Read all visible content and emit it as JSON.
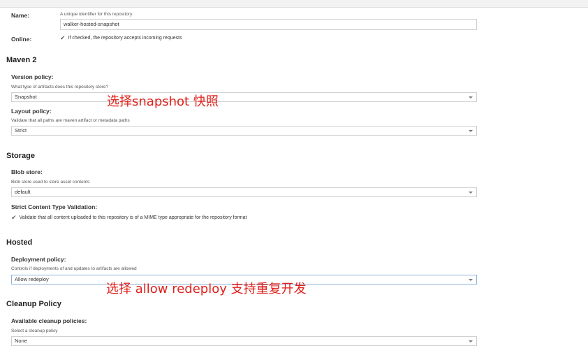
{
  "name": {
    "label": "Name:",
    "help": "A unique identifier for this repository",
    "value": "walker-hosted-snapshot"
  },
  "online": {
    "label": "Online:",
    "checkbox_text": "If checked, the repository accepts incoming requests"
  },
  "maven2": {
    "heading": "Maven 2",
    "version_policy": {
      "label": "Version policy:",
      "help": "What type of artifacts does this repository store?",
      "value": "Snapshot"
    },
    "layout_policy": {
      "label": "Layout policy:",
      "help": "Validate that all paths are maven artifact or metadata paths",
      "value": "Strict"
    }
  },
  "storage": {
    "heading": "Storage",
    "blob_store": {
      "label": "Blob store:",
      "help": "Blob store used to store asset contents",
      "value": "default"
    },
    "strict_content": {
      "label": "Strict Content Type Validation:",
      "checkbox_text": "Validate that all content uploaded to this repository is of a MIME type appropriate for the repository format"
    }
  },
  "hosted": {
    "heading": "Hosted",
    "deployment_policy": {
      "label": "Deployment policy:",
      "help": "Controls if deployments of and updates to artifacts are allowed",
      "value": "Allow redeploy"
    }
  },
  "cleanup": {
    "heading": "Cleanup Policy",
    "available": {
      "label": "Available cleanup policies:",
      "help": "Select a cleanup policy",
      "value": "None"
    }
  },
  "annotations": {
    "snapshot_note": "选择snapshot  快照",
    "redeploy_note": "选择 allow redeploy  支持重复开发"
  },
  "colors": {
    "annotation": "#e0201b",
    "focused_border": "#8fb3d9"
  }
}
